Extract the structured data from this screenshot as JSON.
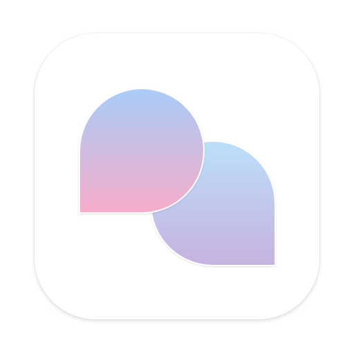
{
  "app_icon": {
    "icon_name": "chat-bubbles-icon",
    "tile_color": "#ffffff",
    "bubble_back": {
      "gradient_top": "#bcdffb",
      "gradient_bottom": "#c6b2e0"
    },
    "bubble_front": {
      "gradient_top": "#a8cdf8",
      "gradient_bottom": "#f6acc9"
    }
  }
}
